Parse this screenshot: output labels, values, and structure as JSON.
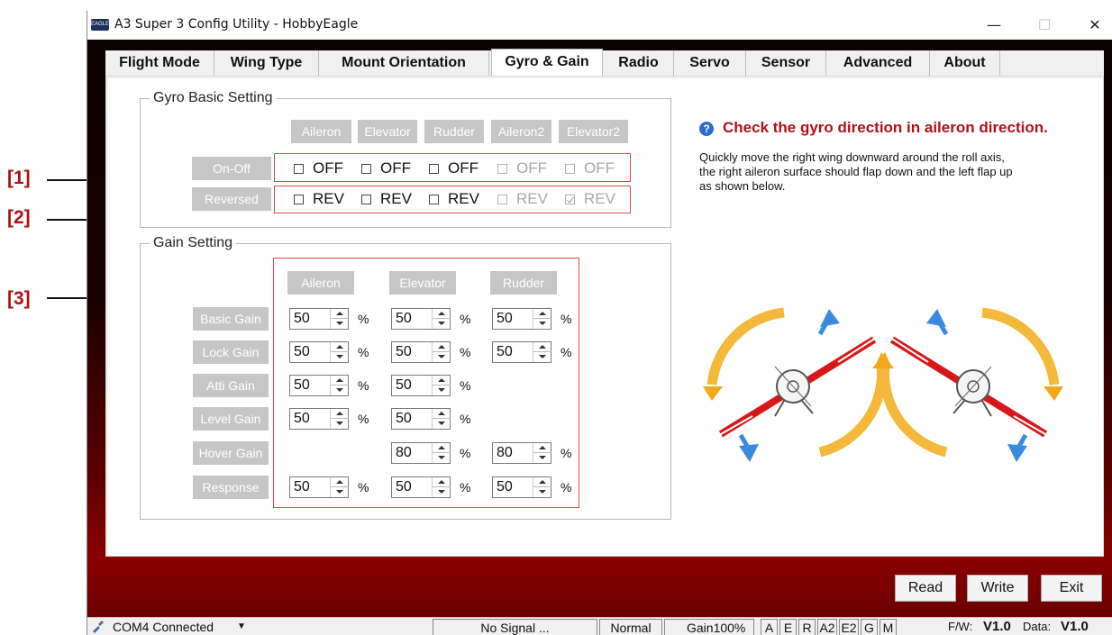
{
  "annotations": [
    "[1]",
    "[2]",
    "[3]"
  ],
  "window": {
    "title": "A3 Super 3 Config Utility - HobbyEagle",
    "logo_text": "EAGLE",
    "minimize": "—",
    "maximize": "☐",
    "close": "✕"
  },
  "tabs": [
    "Flight Mode",
    "Wing Type",
    "Mount Orientation",
    "Gyro & Gain",
    "Radio",
    "Servo",
    "Sensor",
    "Advanced",
    "About"
  ],
  "active_tab": "Gyro & Gain",
  "gyro_basic": {
    "title": "Gyro Basic Setting",
    "columns": [
      "Aileron",
      "Elevator",
      "Rudder",
      "Aileron2",
      "Elevator2"
    ],
    "onoff_label": "On-Off",
    "reversed_label": "Reversed",
    "onoff": [
      {
        "label": "OFF",
        "checked": false,
        "enabled": true
      },
      {
        "label": "OFF",
        "checked": false,
        "enabled": true
      },
      {
        "label": "OFF",
        "checked": false,
        "enabled": true
      },
      {
        "label": "OFF",
        "checked": false,
        "enabled": false
      },
      {
        "label": "OFF",
        "checked": false,
        "enabled": false
      }
    ],
    "reversed": [
      {
        "label": "REV",
        "checked": false,
        "enabled": true
      },
      {
        "label": "REV",
        "checked": false,
        "enabled": true
      },
      {
        "label": "REV",
        "checked": false,
        "enabled": true
      },
      {
        "label": "REV",
        "checked": false,
        "enabled": false
      },
      {
        "label": "REV",
        "checked": true,
        "enabled": false
      }
    ]
  },
  "gain": {
    "title": "Gain Setting",
    "columns": [
      "Aileron",
      "Elevator",
      "Rudder"
    ],
    "unit": "%",
    "rows": [
      {
        "label": "Basic Gain",
        "values": [
          "50",
          "50",
          "50"
        ]
      },
      {
        "label": "Lock Gain",
        "values": [
          "50",
          "50",
          "50"
        ]
      },
      {
        "label": "Atti Gain",
        "values": [
          "50",
          "50",
          null
        ]
      },
      {
        "label": "Level Gain",
        "values": [
          "50",
          "50",
          null
        ]
      },
      {
        "label": "Hover Gain",
        "values": [
          null,
          "80",
          "80"
        ]
      },
      {
        "label": "Response",
        "values": [
          "50",
          "50",
          "50"
        ]
      }
    ]
  },
  "info": {
    "icon": "?",
    "title": "Check the gyro direction in aileron direction.",
    "line1": "Quickly move the right wing downward around the roll axis,",
    "line2": "the right aileron surface should flap down and the left flap up",
    "line3": "as shown below."
  },
  "buttons": {
    "read": "Read",
    "write": "Write",
    "exit": "Exit"
  },
  "status": {
    "connection": "COM4 Connected",
    "signal": "No Signal ...",
    "mode": "Normal",
    "gain": "Gain100%",
    "channels": [
      "A",
      "E",
      "R",
      "A2",
      "E2",
      "G",
      "M"
    ],
    "fw_label": "F/W:",
    "fw_value": "V1.0",
    "data_label": "Data:",
    "data_value": "V1.0"
  },
  "colors": {
    "accent_red": "#b0101a",
    "arrow_orange": "#f2a81a",
    "arrow_blue": "#3a8be0",
    "wing_red": "#d81818"
  }
}
